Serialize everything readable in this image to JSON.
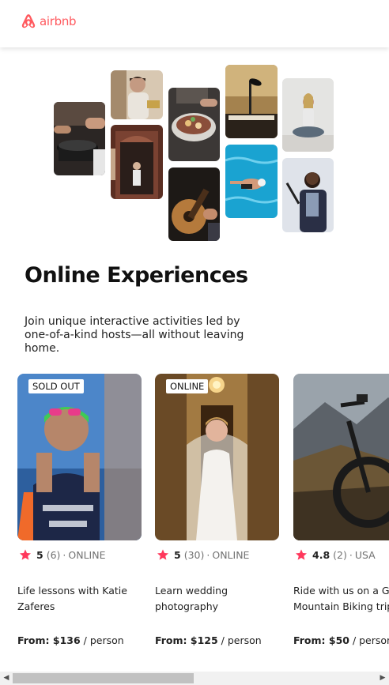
{
  "header": {
    "brand": "airbnb",
    "logo_icon": "airbnb-logo-icon",
    "brand_color": "#ff5a5f"
  },
  "hero": {
    "title": "Online Experiences",
    "subtitle": "Join unique interactive activities led by one-of-a-kind hosts—all without leaving home.",
    "collage_tiles": [
      "cooking",
      "host-portrait",
      "dumplings-bowl",
      "microphone-piano",
      "yoga",
      "door-dance",
      "guitar",
      "swimmer",
      "singer"
    ]
  },
  "cards": [
    {
      "badge": "SOLD OUT",
      "rating": "5",
      "count": "(6)",
      "sep": "·",
      "tag": "ONLINE",
      "title": "Life lessons with Katie Zaferes",
      "price_bold": "From: $136",
      "price_rest": " / person",
      "image": "athlete-portrait"
    },
    {
      "badge": "ONLINE",
      "rating": "5",
      "count": "(30)",
      "sep": "·",
      "tag": "ONLINE",
      "title": "Learn wedding photography",
      "price_bold": "From: $125",
      "price_rest": " / person",
      "image": "bride-portrait"
    },
    {
      "badge": "",
      "rating": "4.8",
      "count": "(2)",
      "sep": "·",
      "tag": "USA",
      "title": "Ride with us on a Grand Mountain Biking trip",
      "price_bold": "From: $50",
      "price_rest": " / person",
      "image": "mountain-bike"
    }
  ],
  "colors": {
    "star": "#ff385c",
    "muted": "#717171"
  }
}
